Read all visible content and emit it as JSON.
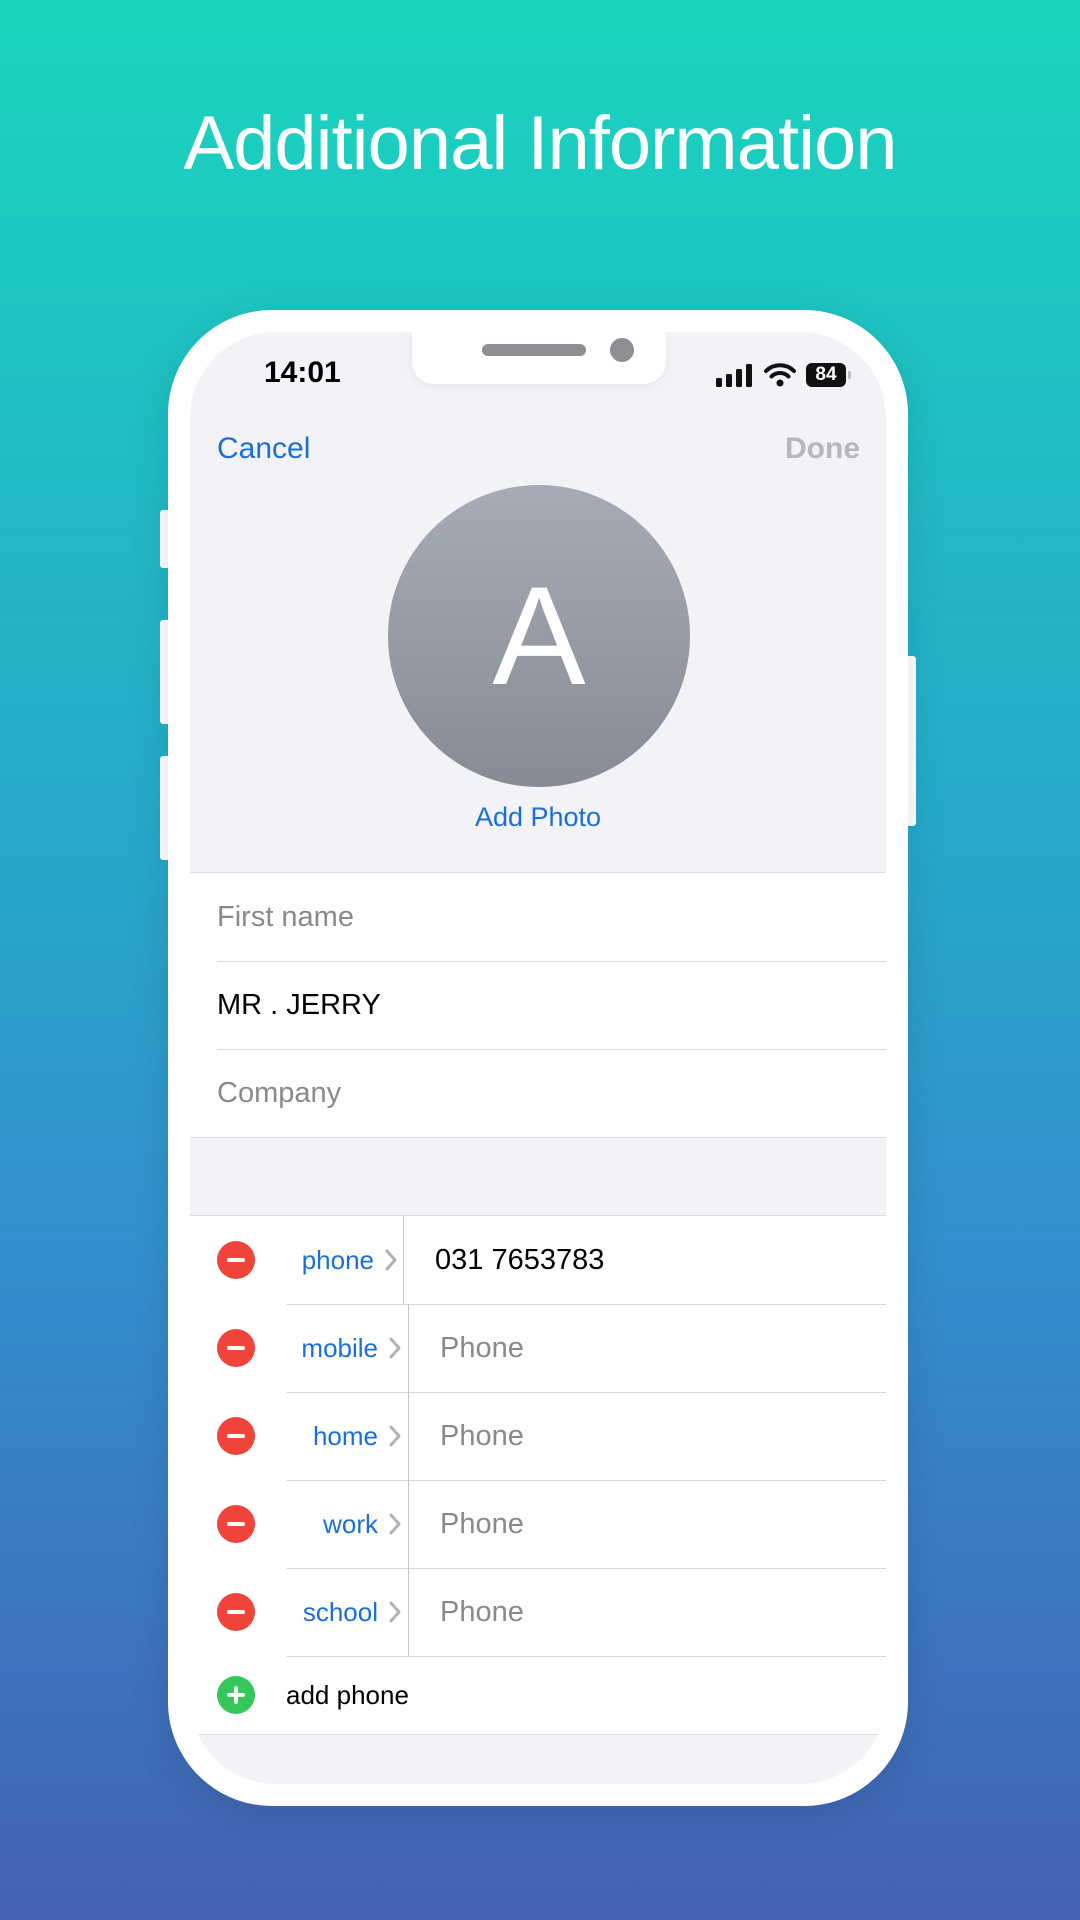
{
  "headline": "Additional Information",
  "status_bar": {
    "time": "14:01",
    "battery": "84"
  },
  "nav": {
    "cancel": "Cancel",
    "done": "Done"
  },
  "avatar": {
    "initial": "A",
    "add_photo": "Add Photo"
  },
  "name_fields": [
    {
      "text": "First name",
      "is_placeholder": true
    },
    {
      "text": "MR . JERRY",
      "is_placeholder": false
    },
    {
      "text": "Company",
      "is_placeholder": true
    }
  ],
  "phone_rows": [
    {
      "label": "phone",
      "value": "031 7653783",
      "is_placeholder": false
    },
    {
      "label": "mobile",
      "value": "Phone",
      "is_placeholder": true
    },
    {
      "label": "home",
      "value": "Phone",
      "is_placeholder": true
    },
    {
      "label": "work",
      "value": "Phone",
      "is_placeholder": true
    },
    {
      "label": "school",
      "value": "Phone",
      "is_placeholder": true
    }
  ],
  "add_phone": "add phone",
  "colors": {
    "accent": "#1b6fd6",
    "remove": "#f0433a",
    "add": "#35c759",
    "done_disabled": "#b7b7bc"
  }
}
